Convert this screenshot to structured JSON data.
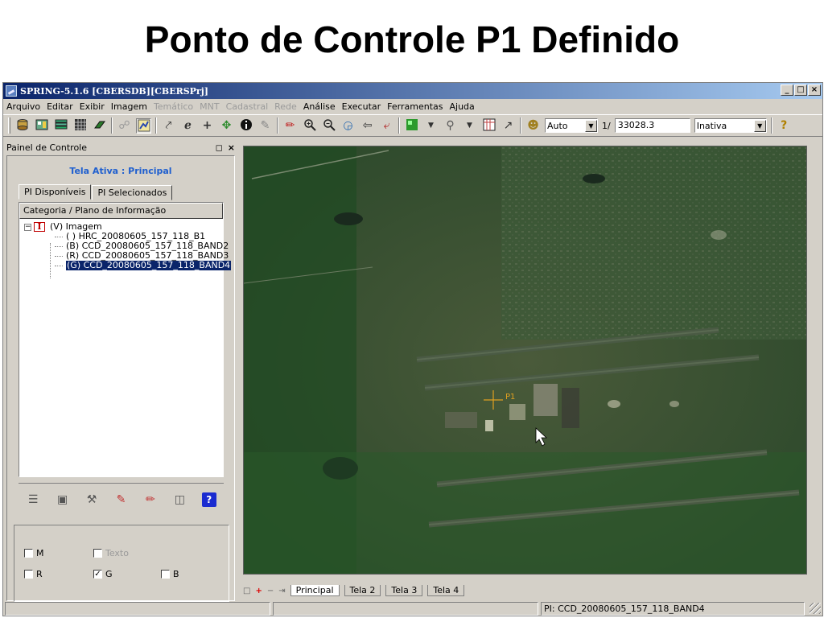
{
  "slide": {
    "title": "Ponto de Controle P1 Definido"
  },
  "window": {
    "title": "SPRING-5.1.6 [CBERSDB][CBERSPrj]",
    "buttons": {
      "minimize": "_",
      "maximize": "□",
      "close": "×"
    }
  },
  "menu": {
    "items": [
      {
        "label": "Arquivo",
        "enabled": true
      },
      {
        "label": "Editar",
        "enabled": true
      },
      {
        "label": "Exibir",
        "enabled": true
      },
      {
        "label": "Imagem",
        "enabled": true
      },
      {
        "label": "Temático",
        "enabled": false
      },
      {
        "label": "MNT",
        "enabled": false
      },
      {
        "label": "Cadastral",
        "enabled": false
      },
      {
        "label": "Rede",
        "enabled": false
      },
      {
        "label": "Análise",
        "enabled": true
      },
      {
        "label": "Executar",
        "enabled": true
      },
      {
        "label": "Ferramentas",
        "enabled": true
      },
      {
        "label": "Ajuda",
        "enabled": true
      }
    ]
  },
  "toolbar": {
    "scale_mode": "Auto",
    "scale_prefix": "1/",
    "scale_value": "33028.3",
    "mode": "Inativa"
  },
  "panel": {
    "title": "Painel de Controle",
    "active_screen": "Tela Ativa : Principal",
    "tabs": [
      "PI Disponíveis",
      "PI Selecionados"
    ],
    "tree_header": "Categoria / Plano de Informação",
    "category": {
      "icon_letter": "I",
      "label": "(V) Imagem"
    },
    "layers": [
      {
        "label": "( ) HRC_20080605_157_118_B1",
        "selected": false
      },
      {
        "label": "(B) CCD_20080605_157_118_BAND2",
        "selected": false
      },
      {
        "label": "(R) CCD_20080605_157_118_BAND3",
        "selected": false
      },
      {
        "label": "(G) CCD_20080605_157_118_BAND4",
        "selected": true
      }
    ],
    "channels": {
      "m": {
        "label": "M",
        "checked": false
      },
      "texto": {
        "label": "Texto",
        "checked": false,
        "enabled": false
      },
      "r": {
        "label": "R",
        "checked": false
      },
      "g": {
        "label": "G",
        "checked": true
      },
      "b": {
        "label": "B",
        "checked": false
      }
    },
    "help_label": "?"
  },
  "map": {
    "point_label": "P1"
  },
  "bottom_tabs": {
    "items": [
      "Principal",
      "Tela 2",
      "Tela 3",
      "Tela 4"
    ],
    "active": "Principal"
  },
  "status": {
    "pi": "PI: CCD_20080605_157_118_BAND4"
  },
  "colors": {
    "title_gradient_start": "#0a246a",
    "title_gradient_end": "#a6caf0",
    "selection": "#0a246a",
    "accent_text": "#1f5fcf",
    "point_marker": "#e0a020"
  }
}
